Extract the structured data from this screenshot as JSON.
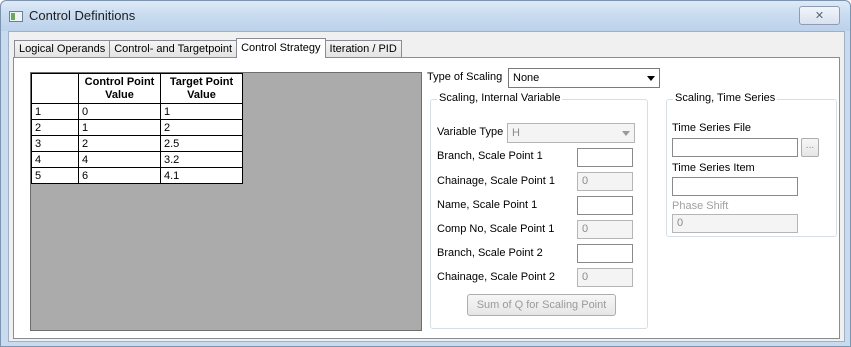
{
  "window": {
    "title": "Control Definitions",
    "close_glyph": "✕"
  },
  "tabs": [
    {
      "label": "Logical Operands"
    },
    {
      "label": "Control- and Targetpoint"
    },
    {
      "label": "Control Strategy"
    },
    {
      "label": "Iteration / PID"
    }
  ],
  "active_tab": "Control Strategy",
  "grid": {
    "columns": [
      "Control Point Value",
      "Target Point Value"
    ],
    "column_lines": [
      [
        "Control Point",
        "Value"
      ],
      [
        "Target Point",
        "Value"
      ]
    ],
    "rows": [
      {
        "index": "1",
        "control": "0",
        "target": "1"
      },
      {
        "index": "2",
        "control": "1",
        "target": "2"
      },
      {
        "index": "3",
        "control": "2",
        "target": "2.5"
      },
      {
        "index": "4",
        "control": "4",
        "target": "3.2"
      },
      {
        "index": "5",
        "control": "6",
        "target": "4.1"
      }
    ]
  },
  "scaling": {
    "type_label": "Type of Scaling",
    "type_value": "None"
  },
  "internal_variable": {
    "title": "Scaling, Internal Variable",
    "variable_type_label": "Variable Type",
    "variable_type_value": "H",
    "fields": [
      {
        "label": "Branch, Scale Point 1",
        "value": ""
      },
      {
        "label": "Chainage, Scale Point 1",
        "value": "0"
      },
      {
        "label": "Name, Scale Point 1",
        "value": ""
      },
      {
        "label": "Comp No, Scale Point 1",
        "value": "0"
      },
      {
        "label": "Branch, Scale Point 2",
        "value": ""
      },
      {
        "label": "Chainage, Scale Point 2",
        "value": "0"
      }
    ],
    "sum_button": "Sum of Q for Scaling Point"
  },
  "time_series": {
    "title": "Scaling, Time Series",
    "file_label": "Time Series File",
    "file_value": "",
    "browse_label": "...",
    "item_label": "Time Series Item",
    "item_value": "",
    "phase_label": "Phase Shift",
    "phase_value": "0"
  },
  "colors": {
    "titlebar": "#c9dcf0",
    "client": "#f0f0f0",
    "grid_background": "#ababab",
    "disabled_text": "#a0a0a0"
  }
}
